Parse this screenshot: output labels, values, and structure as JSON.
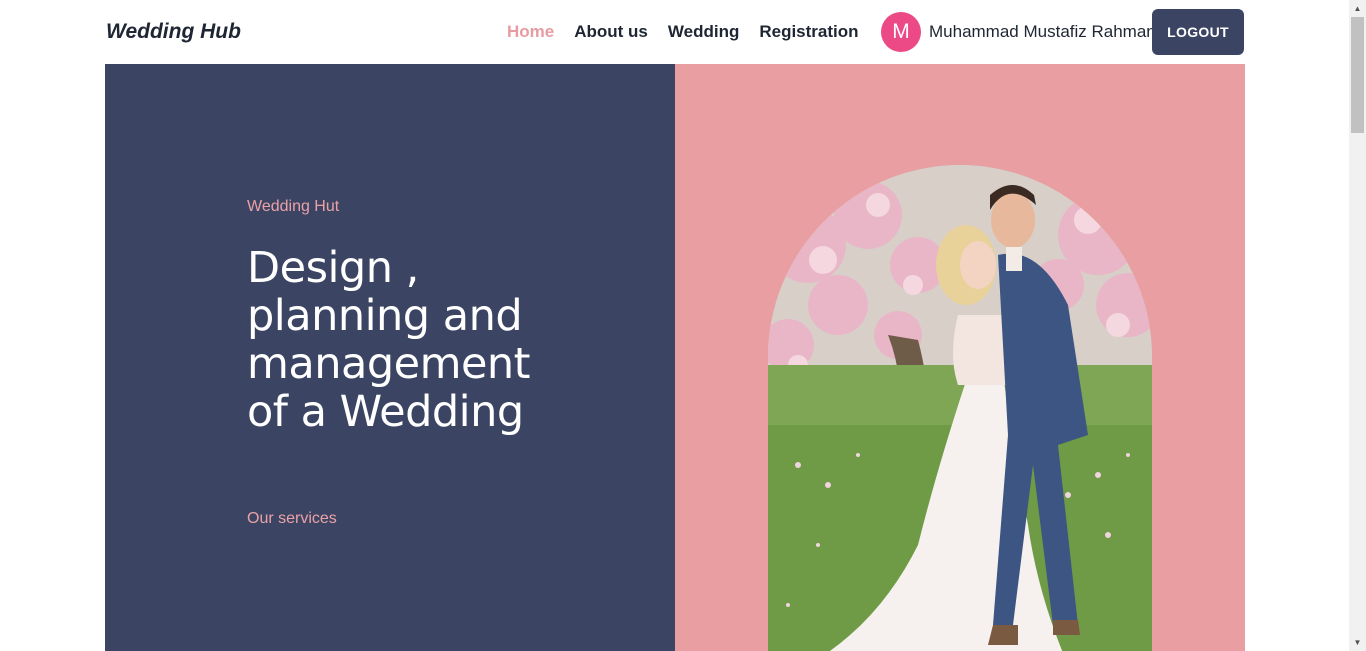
{
  "navbar": {
    "brand": "Wedding Hub",
    "links": [
      {
        "label": "Home",
        "active": true
      },
      {
        "label": "About us",
        "active": false
      },
      {
        "label": "Wedding",
        "active": false
      },
      {
        "label": "Registration",
        "active": false
      }
    ],
    "user": {
      "avatar_initial": "M",
      "name": "Muhammad Mustafiz Rahman"
    },
    "logout_label": "LOGOUT"
  },
  "hero": {
    "eyebrow": "Wedding Hut",
    "headline": "Design , planning and management of a Wedding",
    "cta": "Our services",
    "image_icon": "wedding-couple-photo"
  },
  "colors": {
    "navy": "#3b4563",
    "pink": "#e99ea1",
    "accent_text": "#eaa1a6",
    "avatar": "#ec4a86"
  }
}
